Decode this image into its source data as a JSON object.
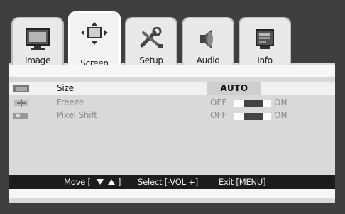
{
  "tabs": [
    {
      "label": "Image",
      "icon": "monitor-icon",
      "active": false
    },
    {
      "label": "Screen",
      "icon": "screen-arrows-icon",
      "active": true
    },
    {
      "label": "Setup",
      "icon": "tools-icon",
      "active": false
    },
    {
      "label": "Audio",
      "icon": "speaker-icon",
      "active": false
    },
    {
      "label": "Info",
      "icon": "info-card-icon",
      "active": false
    }
  ],
  "settings": [
    {
      "label": "Size",
      "value": "AUTO",
      "icon": "size-icon",
      "enabled": true
    },
    {
      "label": "Freeze",
      "off_label": "OFF",
      "on_label": "ON",
      "icon": "freeze-icon",
      "enabled": false
    },
    {
      "label": "Pixel Shift",
      "off_label": "OFF",
      "on_label": "ON",
      "icon": "pixel-shift-icon",
      "enabled": false
    }
  ],
  "hint_bar": {
    "move": "Move [",
    "move_end": "]",
    "select": "Select [-VOL +]",
    "exit": "Exit [MENU]"
  },
  "colors": {
    "frame": "#3f3f3f",
    "panel": "#d9d9d9",
    "hint_bar": "#1c1c1c",
    "selected_row": "#f1f1f1"
  }
}
